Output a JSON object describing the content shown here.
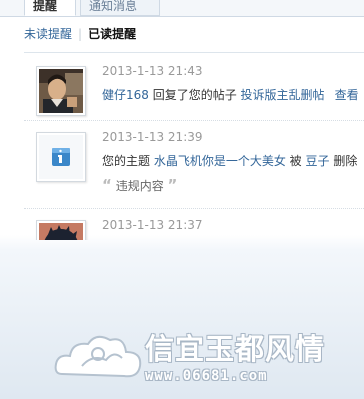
{
  "tabs": [
    {
      "label": "提醒",
      "active": true
    },
    {
      "label": "通知消息",
      "active": false
    }
  ],
  "subnav": {
    "unread": "未读提醒",
    "separator": "|",
    "read": "已读提醒"
  },
  "notices": [
    {
      "time": "2013-1-13 21:43",
      "user": "健仔168",
      "action": " 回复了您的帖子 ",
      "target": "投诉版主乱删帖",
      "link": "查看",
      "avatar_icon": "user-photo-icon"
    },
    {
      "time": "2013-1-13 21:39",
      "prefix": "您的主题 ",
      "topic": "水晶飞机你是一个大美女",
      "middle": " 被 ",
      "user": "豆子",
      "action": " 删除",
      "quote_open": "“",
      "quote": "违规内容",
      "quote_close": "”",
      "avatar_icon": "system-notice-icon"
    },
    {
      "time": "2013-1-13 21:37",
      "avatar_icon": "anime-avatar-icon"
    }
  ],
  "watermark": {
    "text": "信宜玉都风情",
    "url": "www.06681.com"
  },
  "colors": {
    "link": "#336699",
    "time": "#999999",
    "border": "#cfd9e4"
  }
}
